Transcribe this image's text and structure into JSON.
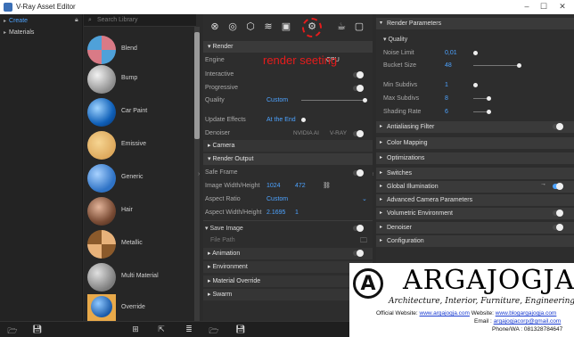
{
  "window": {
    "title": "V-Ray Asset Editor"
  },
  "tree": {
    "items": [
      {
        "label": "Create"
      },
      {
        "label": "Materials"
      }
    ]
  },
  "library": {
    "search_placeholder": "Search Library",
    "materials": [
      {
        "label": "Blend"
      },
      {
        "label": "Bump"
      },
      {
        "label": "Car Paint"
      },
      {
        "label": "Emissive"
      },
      {
        "label": "Generic"
      },
      {
        "label": "Hair"
      },
      {
        "label": "Metallic"
      },
      {
        "label": "Multi Material"
      },
      {
        "label": "Override"
      }
    ]
  },
  "toolbar": {
    "icons": [
      "sphere-icon",
      "lightbulb-icon",
      "cube-icon",
      "layers-icon",
      "render-elements-icon",
      "gear-icon",
      "teapot-icon",
      "frame-buffer-icon"
    ]
  },
  "annotation": {
    "text": "render seeting"
  },
  "render": {
    "header": "Render",
    "engine_label": "Engine",
    "engine_value": "CPU",
    "interactive_label": "Interactive",
    "progressive_label": "Progressive",
    "quality_label": "Quality",
    "quality_value": "Custom",
    "update_effects_label": "Update Effects",
    "update_effects_value": "At the End",
    "denoiser_label": "Denoiser",
    "denoiser_nvidia": "NVIDIA AI",
    "denoiser_vray": "V-RAY"
  },
  "camera": {
    "header": "Camera"
  },
  "render_output": {
    "header": "Render Output",
    "safe_frame_label": "Safe Frame",
    "image_wh_label": "Image Width/Height",
    "width": "1024",
    "height": "472",
    "aspect_ratio_label": "Aspect Ratio",
    "aspect_ratio_value": "Custom",
    "aspect_wh_label": "Aspect Width/Height",
    "aspect_w": "2.1695",
    "aspect_h": "1",
    "save_image_label": "Save Image",
    "file_path_label": "File Path"
  },
  "center_sections": [
    {
      "label": "Animation"
    },
    {
      "label": "Environment"
    },
    {
      "label": "Material Override"
    },
    {
      "label": "Swarm"
    }
  ],
  "right": {
    "header": "Render Parameters",
    "quality_header": "Quality",
    "params": [
      {
        "label": "Noise Limit",
        "value": "0,01"
      },
      {
        "label": "Bucket Size",
        "value": "48"
      },
      {
        "label": "Min Subdivs",
        "value": "1"
      },
      {
        "label": "Max Subdivs",
        "value": "8"
      },
      {
        "label": "Shading Rate",
        "value": "6"
      }
    ],
    "sections": [
      {
        "label": "Antialiasing Filter"
      },
      {
        "label": "Color Mapping"
      },
      {
        "label": "Optimizations"
      },
      {
        "label": "Switches"
      },
      {
        "label": "Global Illumination"
      },
      {
        "label": "Advanced Camera Parameters"
      },
      {
        "label": "Volumetric Environment"
      },
      {
        "label": "Denoiser"
      },
      {
        "label": "Configuration"
      }
    ]
  },
  "watermark": {
    "letter": "A",
    "brand": "ARGAJOGJA",
    "tagline": "Architecture, Interior, Furniture, Engineering",
    "official_label": "Official Website:",
    "official_url": "www.argajogja.com",
    "website_label": "Website:",
    "website_url": "www.blogargajogja.com",
    "email_label": "Email :",
    "email": "argajogjacorp@gmail.com",
    "phone": "Phone/WA : 081328784647"
  },
  "colors": {
    "accent": "#4da3ff",
    "annotation": "#e61c1c",
    "panel": "#2d2d2d"
  }
}
